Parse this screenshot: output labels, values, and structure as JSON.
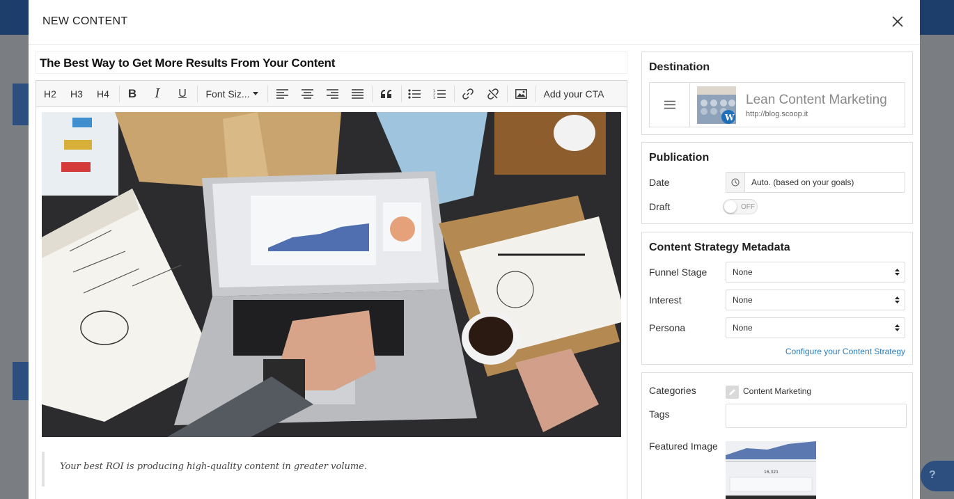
{
  "modal": {
    "title": "NEW CONTENT",
    "close_icon": "close-icon"
  },
  "editor": {
    "title_value": "The Best Way to Get More Results From Your Content",
    "toolbar": {
      "h2": "H2",
      "h3": "H3",
      "h4": "H4",
      "bold": "B",
      "italic": "I",
      "underline": "U",
      "font_size": "Font Siz...",
      "cta": "Add your CTA",
      "icons": [
        "align-left-icon",
        "align-center-icon",
        "align-right-icon",
        "align-justify-icon",
        "quote-icon",
        "bullet-list-icon",
        "numbered-list-icon",
        "link-icon",
        "unlink-icon",
        "image-icon"
      ]
    },
    "quote": "Your best ROI is producing high-quality content in greater volume."
  },
  "destination": {
    "title": "Destination",
    "name": "Lean Content Marketing",
    "url": "http://blog.scoop.it"
  },
  "publication": {
    "title": "Publication",
    "date_label": "Date",
    "date_value": "Auto. (based on your goals)",
    "draft_label": "Draft",
    "draft_state": "OFF"
  },
  "strategy": {
    "title": "Content Strategy Metadata",
    "funnel_label": "Funnel Stage",
    "funnel_value": "None",
    "interest_label": "Interest",
    "interest_value": "None",
    "persona_label": "Persona",
    "persona_value": "None",
    "configure_link": "Configure your Content Strategy"
  },
  "meta": {
    "categories_label": "Categories",
    "category_value": "Content Marketing",
    "tags_label": "Tags",
    "tags_value": "",
    "featured_label": "Featured Image"
  },
  "colors": {
    "link": "#2a7ab8",
    "topbar": "#1d3d6b"
  }
}
